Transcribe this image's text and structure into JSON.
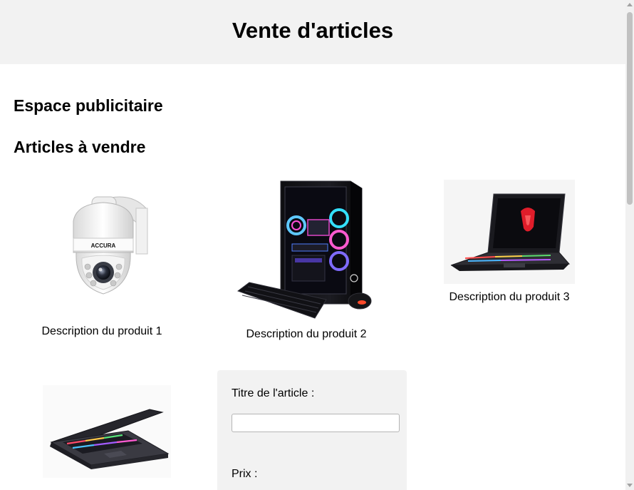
{
  "header": {
    "title": "Vente d'articles"
  },
  "ads": {
    "title": "Espace publicitaire"
  },
  "articles": {
    "title": "Articles à vendre",
    "items": [
      {
        "description": "Description du produit 1",
        "image": "security-camera-icon"
      },
      {
        "description": "Description du produit 2",
        "image": "gaming-desktop-icon"
      },
      {
        "description": "Description du produit 3",
        "image": "laptop-icon"
      },
      {
        "description": "",
        "image": "laptop-icon"
      }
    ]
  },
  "form": {
    "title_label": "Titre de l'article :",
    "title_value": "",
    "price_label": "Prix :"
  },
  "brand_text": "ACCURA"
}
